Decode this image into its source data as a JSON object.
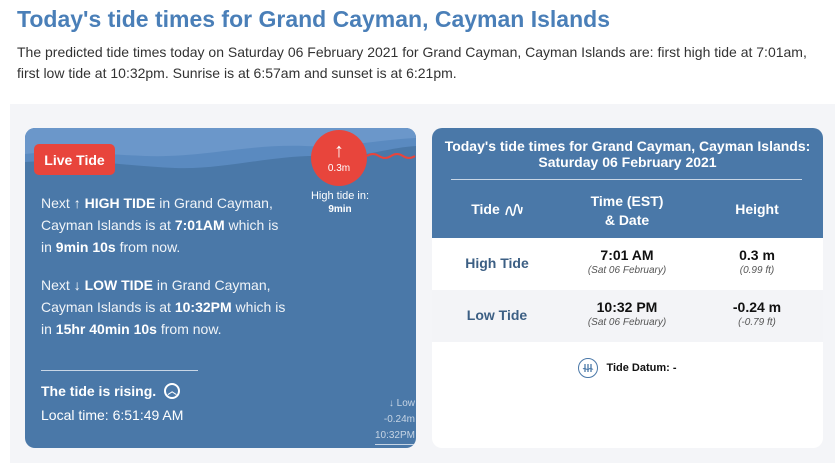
{
  "header": {
    "title": "Today's tide times for Grand Cayman, Cayman Islands",
    "intro": "The predicted tide times today on Saturday 06 February 2021 for Grand Cayman, Cayman Islands are: first high tide at 7:01am, first low tide at 10:32pm. Sunrise is at 6:57am and sunset is at 6:21pm."
  },
  "live": {
    "badge": "Live Tide",
    "next_high_value": "0.3m",
    "high_tide_in_label": "High tide in:",
    "high_tide_in_value": "9min",
    "next_label": "Next",
    "high_arrow": "↑",
    "high_label": "HIGH TIDE",
    "high_text_1": "in Grand Cayman, Cayman Islands is at",
    "high_time": "7:01AM",
    "high_text_2": "which is in",
    "high_countdown": "9min 10s",
    "high_text_3": "from now.",
    "low_arrow": "↓",
    "low_label": "LOW TIDE",
    "low_text_1": "in Grand Cayman, Cayman Islands is at",
    "low_time": "10:32PM",
    "low_text_2": "which is in",
    "low_countdown": "15hr 40min 10s",
    "low_text_3": "from now.",
    "rising_text": "The tide is rising.",
    "local_time": "Local time: 6:51:49 AM",
    "low_marker_label": "↓ Low",
    "low_marker_value": "-0.24m",
    "low_marker_time": "10:32PM",
    "colors": {
      "card": "#4a78a8",
      "accent": "#e8453c"
    }
  },
  "table": {
    "title_line1": "Today's tide times for Grand Cayman, Cayman Islands:",
    "title_line2": "Saturday 06 February 2021",
    "col_tide": "Tide",
    "col_time_1": "Time (EST)",
    "col_time_2": "& Date",
    "col_height": "Height",
    "rows": [
      {
        "tide": "High Tide",
        "time": "7:01 AM",
        "date": "(Sat 06 February)",
        "height": "0.3 m",
        "height_ft": "(0.99 ft)"
      },
      {
        "tide": "Low Tide",
        "time": "10:32 PM",
        "date": "(Sat 06 February)",
        "height": "-0.24 m",
        "height_ft": "(-0.79 ft)"
      }
    ],
    "datum_label": "Tide Datum: -"
  }
}
